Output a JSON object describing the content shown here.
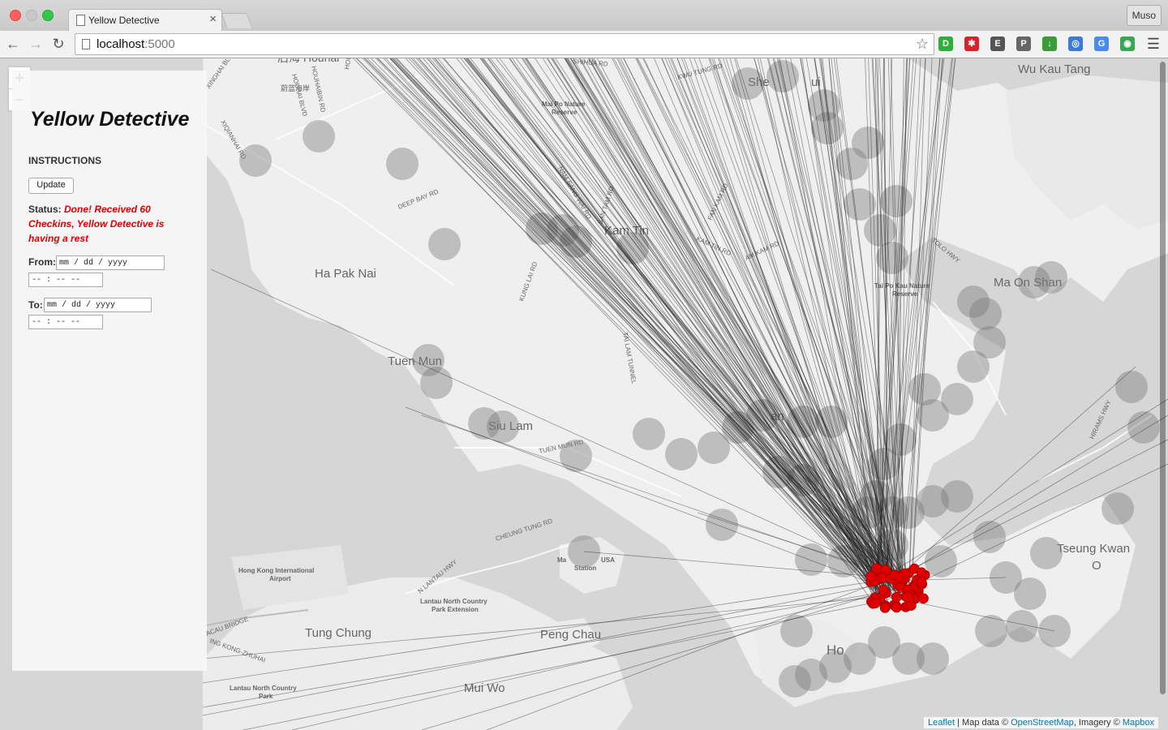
{
  "browser": {
    "tab_title": "Yellow Detective",
    "tab_close": "×",
    "profile": "Muso",
    "url_host": "localhost",
    "url_port": ":5000",
    "back": "←",
    "forward": "→",
    "reload": "↻",
    "star": "☆",
    "menu": "☰",
    "extensions": [
      {
        "icon": "d-icon",
        "glyph": "D",
        "color": "#2fae3a"
      },
      {
        "icon": "asterisk-icon",
        "glyph": "✱",
        "color": "#d8232a"
      },
      {
        "icon": "evernote-icon",
        "glyph": "E",
        "color": "#555555"
      },
      {
        "icon": "pocket-icon",
        "glyph": "P",
        "color": "#666666"
      },
      {
        "icon": "download-icon",
        "glyph": "↓",
        "color": "#3a9d3a"
      },
      {
        "icon": "globe-icon",
        "glyph": "◎",
        "color": "#3b7ad8"
      },
      {
        "icon": "translate-icon",
        "glyph": "G",
        "color": "#4a8af4"
      },
      {
        "icon": "gear-green-icon",
        "glyph": "◉",
        "color": "#36a852"
      }
    ]
  },
  "map": {
    "zoom_in": "+",
    "zoom_out": "−",
    "labels": [
      {
        "text": "Wu Kau Tang",
        "type": "town"
      },
      {
        "text": "Kam Tin",
        "type": "town"
      },
      {
        "text": "Ha Pak Nai",
        "type": "town"
      },
      {
        "text": "Tuen Mun",
        "type": "town"
      },
      {
        "text": "Siu Lam",
        "type": "town"
      },
      {
        "text": "Ma On Shan",
        "type": "town"
      },
      {
        "text": "Tseung Kwan",
        "type": "town"
      },
      {
        "text": "O",
        "type": "town"
      },
      {
        "text": "Tung Chung",
        "type": "town"
      },
      {
        "text": "Peng Chau",
        "type": "town"
      },
      {
        "text": "Mui Wo",
        "type": "town"
      },
      {
        "text": "Ho",
        "type": "town"
      },
      {
        "text": "She",
        "type": "town"
      },
      {
        "text": "ui",
        "type": "town"
      },
      {
        "text": "an",
        "type": "town"
      },
      {
        "text": "Mai Po Nature",
        "type": "park"
      },
      {
        "text": "Reserve",
        "type": "park"
      },
      {
        "text": "Tai Po Kau Nature",
        "type": "park"
      },
      {
        "text": "Reserve",
        "type": "park"
      },
      {
        "text": "Hong Kong International",
        "type": "park"
      },
      {
        "text": "Airport",
        "type": "park"
      },
      {
        "text": "Lantau North Country",
        "type": "park"
      },
      {
        "text": "Park Extension",
        "type": "park"
      },
      {
        "text": "Lantau North Country",
        "type": "park"
      },
      {
        "text": "Park",
        "type": "park"
      },
      {
        "text": "Ma",
        "type": "park"
      },
      {
        "text": "USA",
        "type": "park"
      },
      {
        "text": "Station",
        "type": "park"
      },
      {
        "text": "KWU TUNG RD",
        "type": "road"
      },
      {
        "text": "SHIHUA RD",
        "type": "road"
      },
      {
        "text": "DEEP BAY RD",
        "type": "road"
      },
      {
        "text": "SAN TAM RD",
        "type": "road"
      },
      {
        "text": "FAN KAM RD",
        "type": "road"
      },
      {
        "text": "KAM TIN RD",
        "type": "road"
      },
      {
        "text": "AM KAM RD",
        "type": "road"
      },
      {
        "text": "TOLO HWY",
        "type": "road"
      },
      {
        "text": "TUEN MUN RD",
        "type": "road"
      },
      {
        "text": "CHEUNG TUNG RD",
        "type": "road"
      },
      {
        "text": "N LANTAU HWY",
        "type": "road"
      },
      {
        "text": "TAI LAM TUNNEL",
        "type": "road"
      },
      {
        "text": "KUNG LAI RD",
        "type": "road"
      },
      {
        "text": "XINGHAI BLVD",
        "type": "road"
      },
      {
        "text": "XIQIANHAI RD",
        "type": "road"
      },
      {
        "text": "HIRAMS HWY",
        "type": "road"
      },
      {
        "text": "NAM SANG WAI RD",
        "type": "road"
      },
      {
        "text": "ACAU BRIDGE",
        "type": "road"
      },
      {
        "text": "ING KONG-ZHUHAI",
        "type": "road"
      },
      {
        "text": "后海 Houhai",
        "type": "town"
      },
      {
        "text": "HOUHAIBIN RD",
        "type": "road"
      },
      {
        "text": "HOUHAI BLVD",
        "type": "road"
      },
      {
        "text": "HOUHAI RD",
        "type": "road"
      },
      {
        "text": "蔚蓝海岸",
        "type": "road"
      }
    ],
    "attribution": {
      "leaflet": "Leaflet",
      "sep1": " | Map data © ",
      "osm": "OpenStreetMap",
      "sep2": ", Imagery © ",
      "mapbox": "Mapbox"
    }
  },
  "panel": {
    "title": "Yellow Detective",
    "instructions": "INSTRUCTIONS",
    "update_button": "Update",
    "status_label": "Status:",
    "status_message": "Done! Received 60 Checkins, Yellow Detective is having a rest",
    "from_label": "From:",
    "from_date_placeholder": "mm / dd / yyyy",
    "from_time_placeholder": "-- : --  --",
    "to_label": "To:",
    "to_date_placeholder": "mm / dd / yyyy",
    "to_time_placeholder": "-- : --  --"
  }
}
